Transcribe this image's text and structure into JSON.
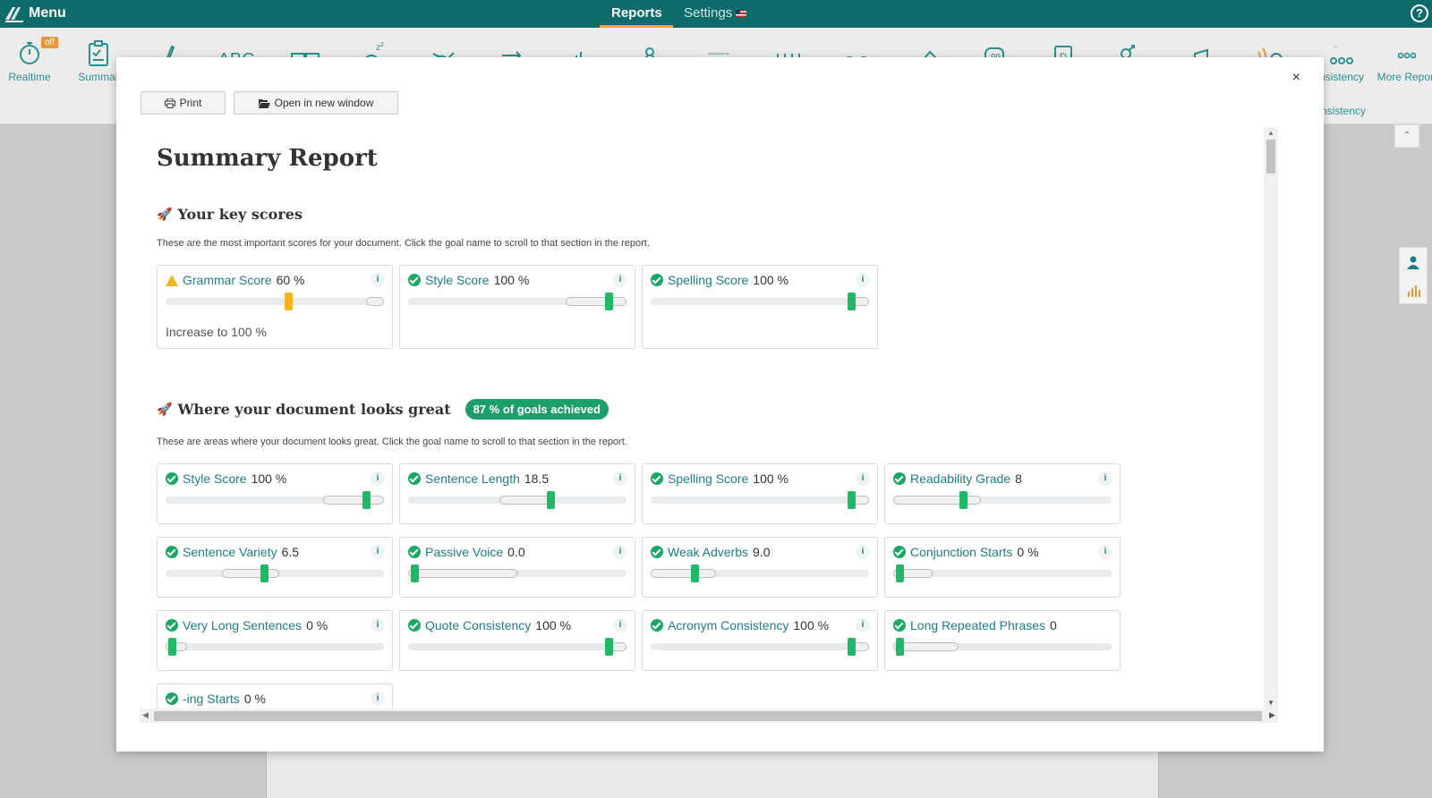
{
  "topbar": {
    "menu_label": "Menu",
    "tabs": [
      {
        "label": "Reports",
        "active": true
      },
      {
        "label": "Settings",
        "active": false
      }
    ],
    "help_icon": "?"
  },
  "toolbar": {
    "items": [
      {
        "icon": "stopwatch-icon",
        "label": "Realtime",
        "badge": "off"
      },
      {
        "icon": "clipboard-icon",
        "label": "Summar"
      },
      {
        "icon": "pen-icon",
        "label": ""
      },
      {
        "icon": "abc-icon",
        "label": "",
        "glyph": "ABC"
      },
      {
        "icon": "book-icon",
        "label": ""
      },
      {
        "icon": "sleep-icon",
        "label": ""
      },
      {
        "icon": "shuffle-icon",
        "label": ""
      },
      {
        "icon": "arrows-icon",
        "label": ""
      },
      {
        "icon": "bars-chart-icon",
        "label": ""
      },
      {
        "icon": "network-icon",
        "label": ""
      },
      {
        "icon": "lines-icon",
        "label": ""
      },
      {
        "icon": "bridge-icon",
        "label": ""
      },
      {
        "icon": "glasses-icon",
        "label": ""
      },
      {
        "icon": "eraser-icon",
        "label": ""
      },
      {
        "icon": "quote-icon",
        "label": ""
      },
      {
        "icon": "document-d-icon",
        "label": ""
      },
      {
        "icon": "gender-icon",
        "label": ""
      },
      {
        "icon": "music-icon",
        "label": ""
      },
      {
        "icon": "sound-icon",
        "label": ""
      },
      {
        "icon": "consistency-icon",
        "label": "nsistency"
      },
      {
        "icon": "more-icon",
        "label": "More Report"
      }
    ],
    "sublabel": "nsistency"
  },
  "modal": {
    "close_icon": "×",
    "print_label": "Print",
    "open_window_label": "Open in new window",
    "title": "Summary Report",
    "key_scores": {
      "heading": "Your key scores",
      "description": "These are the most important scores for your document. Click the goal name to scroll to that section in the report.",
      "cards": [
        {
          "name": "Grammar Score",
          "value": "60 %",
          "status": "warning",
          "footer": "Increase to 100 %",
          "level": 0.56,
          "range": [
            0.92,
            1.0
          ]
        },
        {
          "name": "Style Score",
          "value": "100 %",
          "status": "ok",
          "footer": "",
          "level": 0.92,
          "range": [
            0.72,
            1.0
          ]
        },
        {
          "name": "Spelling Score",
          "value": "100 %",
          "status": "ok",
          "footer": "",
          "level": 0.92,
          "range": [
            0.92,
            1.0
          ]
        }
      ]
    },
    "great": {
      "heading": "Where your document looks great",
      "badge": "87 % of goals achieved",
      "description": "These are areas where your document looks great. Click the goal name to scroll to that section in the report.",
      "cards": [
        {
          "name": "Style Score",
          "value": "100 %",
          "level": 0.92,
          "range": [
            0.72,
            1.0
          ],
          "info": true
        },
        {
          "name": "Sentence Length",
          "value": "18.5",
          "level": 0.65,
          "range": [
            0.42,
            0.67
          ],
          "info": true
        },
        {
          "name": "Spelling Score",
          "value": "100 %",
          "level": 0.92,
          "range": [
            0.92,
            1.0
          ],
          "info": true
        },
        {
          "name": "Readability Grade",
          "value": "8",
          "level": 0.32,
          "range": [
            0.0,
            0.4
          ],
          "info": true
        },
        {
          "name": "Sentence Variety",
          "value": "6.5",
          "level": 0.45,
          "range": [
            0.26,
            0.52
          ],
          "info": true
        },
        {
          "name": "Passive Voice",
          "value": "0.0",
          "level": 0.03,
          "range": [
            0.0,
            0.5
          ],
          "info": true
        },
        {
          "name": "Weak Adverbs",
          "value": "9.0",
          "level": 0.2,
          "range": [
            0.0,
            0.3
          ],
          "info": true
        },
        {
          "name": "Conjunction Starts",
          "value": "0 %",
          "level": 0.03,
          "range": [
            0.0,
            0.18
          ],
          "info": true
        },
        {
          "name": "Very Long Sentences",
          "value": "0 %",
          "level": 0.03,
          "range": [
            0.0,
            0.1
          ],
          "info": true
        },
        {
          "name": "Quote Consistency",
          "value": "100 %",
          "level": 0.92,
          "range": [
            0.92,
            1.0
          ],
          "info": true
        },
        {
          "name": "Acronym Consistency",
          "value": "100 %",
          "level": 0.92,
          "range": [
            0.92,
            1.0
          ],
          "info": true
        },
        {
          "name": "Long Repeated Phrases",
          "value": "0",
          "level": 0.03,
          "range": [
            0.0,
            0.3
          ],
          "info": false
        },
        {
          "name": "-ing Starts",
          "value": "0 %",
          "level": 0.03,
          "range": [
            0.0,
            0.1
          ],
          "info": true
        }
      ]
    }
  },
  "colors": {
    "topbar": "#0e6b6b",
    "accent": "#1e7d84",
    "ok": "#1ba865",
    "warning": "#f0b323",
    "badge": "#1e9e6a"
  }
}
